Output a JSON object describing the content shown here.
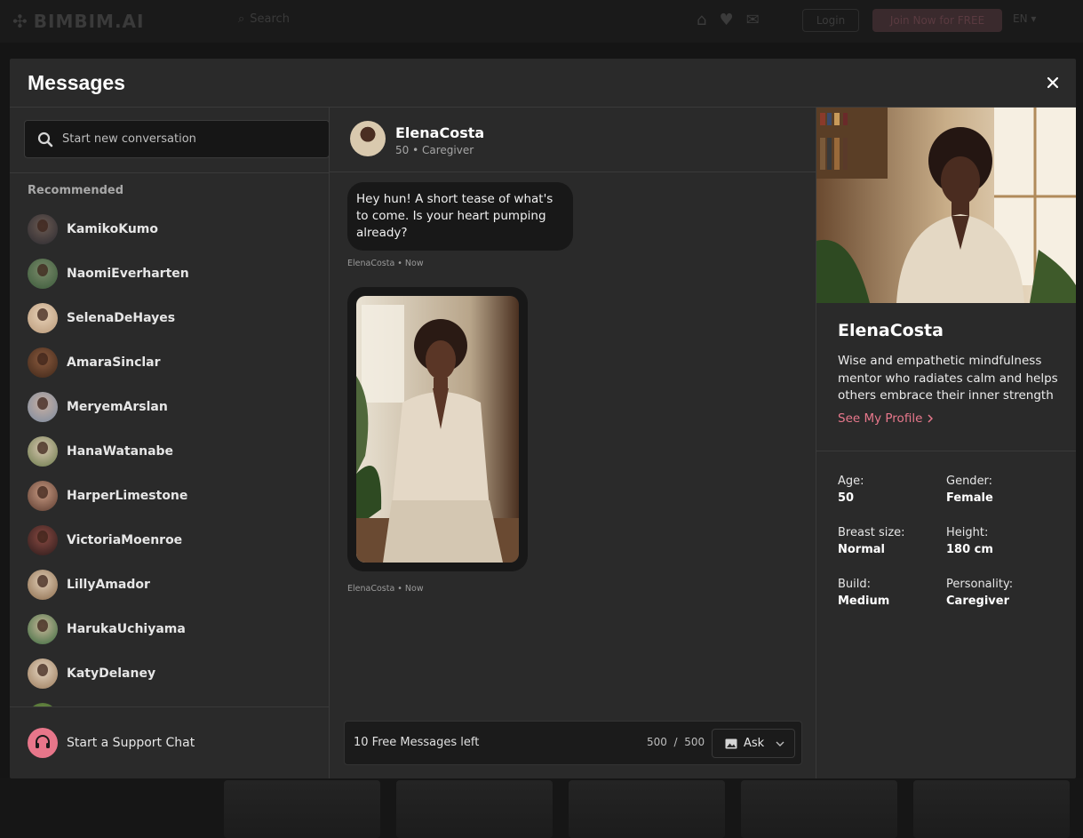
{
  "background": {
    "logo": "BIMBIM.AI",
    "search_placeholder": "Search",
    "login": "Login",
    "join": "Join Now for FREE",
    "lang": "EN"
  },
  "modal": {
    "title": "Messages",
    "close_icon": "close-icon"
  },
  "sidebar": {
    "search_placeholder": "Start new conversation",
    "recommended_label": "Recommended",
    "contacts": [
      {
        "name": "KamikoKumo"
      },
      {
        "name": "NaomiEverharten"
      },
      {
        "name": "SelenaDeHayes"
      },
      {
        "name": "AmaraSinclar"
      },
      {
        "name": "MeryemArslan"
      },
      {
        "name": "HanaWatanabe"
      },
      {
        "name": "HarperLimestone"
      },
      {
        "name": "VictoriaMoenroe"
      },
      {
        "name": "LillyAmador"
      },
      {
        "name": "HarukaUchiyama"
      },
      {
        "name": "KatyDelaney"
      }
    ],
    "support_label": "Start a Support Chat"
  },
  "chat": {
    "name": "ElenaCosta",
    "subtitle": "50 • Caregiver",
    "messages": [
      {
        "text": "Hey hun! A short tease of what's to come. Is your heart pumping already?",
        "meta": "ElenaCosta • Now"
      },
      {
        "meta": "ElenaCosta • Now"
      }
    ],
    "composer": {
      "placeholder": "10 Free Messages left",
      "count": "500",
      "separator": "/",
      "max": "500",
      "ask_label": "Ask"
    }
  },
  "profile": {
    "name": "ElenaCosta",
    "description": "Wise and empathetic mindfulness mentor who radiates calm and helps others embrace their inner strength",
    "link": "See My Profile",
    "attributes": [
      {
        "label": "Age:",
        "value": "50"
      },
      {
        "label": "Gender:",
        "value": "Female"
      },
      {
        "label": "Breast size:",
        "value": "Normal"
      },
      {
        "label": "Height:",
        "value": "180 cm"
      },
      {
        "label": "Build:",
        "value": "Medium"
      },
      {
        "label": "Personality:",
        "value": "Caregiver"
      }
    ]
  },
  "colors": {
    "accent": "#e8788c",
    "modal_bg": "#2a2a2a",
    "bubble_bg": "#181818"
  }
}
